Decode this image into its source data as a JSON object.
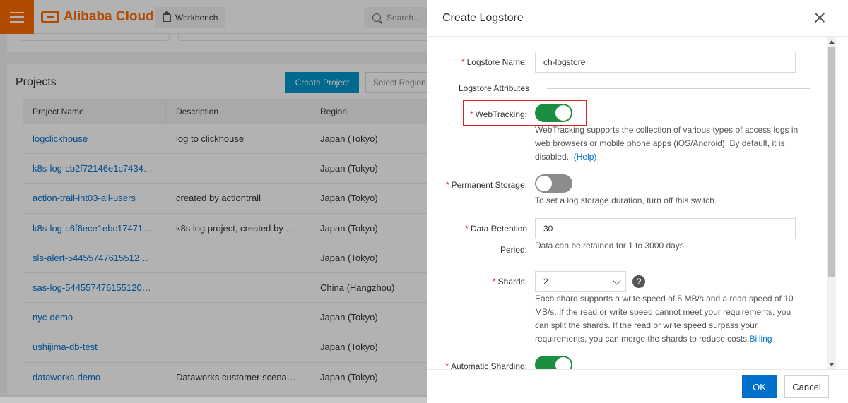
{
  "topbar": {
    "brand": "Alibaba Cloud",
    "workbench_label": "Workbench",
    "search_placeholder": "Search..."
  },
  "projects": {
    "title": "Projects",
    "create_button": "Create Project",
    "region_select": "Select Region",
    "columns": [
      "Project Name",
      "Description",
      "Region"
    ],
    "rows": [
      {
        "name": "logclickhouse",
        "description": "log to clickhouse",
        "region": "Japan (Tokyo)"
      },
      {
        "name": "k8s-log-cb2f72146e1c7434…",
        "description": "",
        "region": "Japan (Tokyo)"
      },
      {
        "name": "action-trail-int03-all-users",
        "description": "created by actiontrail",
        "region": "Japan (Tokyo)"
      },
      {
        "name": "k8s-log-c6f6ece1ebc17471…",
        "description": "k8s log project, created by …",
        "region": "Japan (Tokyo)"
      },
      {
        "name": "sls-alert-54455747615512…",
        "description": "",
        "region": "Japan (Tokyo)"
      },
      {
        "name": "sas-log-544557476155120…",
        "description": "",
        "region": "China (Hangzhou)"
      },
      {
        "name": "nyc-demo",
        "description": "",
        "region": "Japan (Tokyo)"
      },
      {
        "name": "ushijima-db-test",
        "description": "",
        "region": "Japan (Tokyo)"
      },
      {
        "name": "dataworks-demo",
        "description": "Dataworks customer scena…",
        "region": "Japan (Tokyo)"
      }
    ]
  },
  "drawer": {
    "title": "Create Logstore",
    "logstore_name_label": "Logstore Name:",
    "logstore_name_value": "ch-logstore",
    "attributes_section": "Logstore Attributes",
    "webtracking_label": "WebTracking:",
    "webtracking_enabled": true,
    "webtracking_help": "WebTracking supports the collection of various types of access logs in web browsers or mobile phone apps (iOS/Android). By default, it is disabled.",
    "webtracking_help_link": "(Help)",
    "permanent_storage_label": "Permanent Storage:",
    "permanent_storage_enabled": false,
    "permanent_storage_help": "To set a log storage duration, turn off this switch.",
    "data_retention_label_line1": "Data Retention",
    "data_retention_label_line2": "Period:",
    "data_retention_value": "30",
    "data_retention_help": "Data can be retained for 1 to 3000 days.",
    "shards_label": "Shards:",
    "shards_value": "2",
    "shards_help_icon": "?",
    "shards_help": "Each shard supports a write speed of 5 MB/s and a read speed of 10 MB/s. If the read or write speed cannot meet your requirements, you can split the shards. If the read or write speed surpass your requirements, you can merge the shards to reduce costs.",
    "shards_help_link": "Billing",
    "auto_sharding_label": "Automatic Sharding:",
    "auto_sharding_enabled": true,
    "ok_button": "OK",
    "cancel_button": "Cancel"
  },
  "colors": {
    "brand_orange": "#ff6a00",
    "primary_blue": "#0070cc",
    "create_blue": "#0099cc",
    "toggle_on": "#1b8f3f",
    "toggle_off": "#8c8c8c",
    "required_red": "#e62e2e",
    "highlight_red": "#e02020"
  }
}
